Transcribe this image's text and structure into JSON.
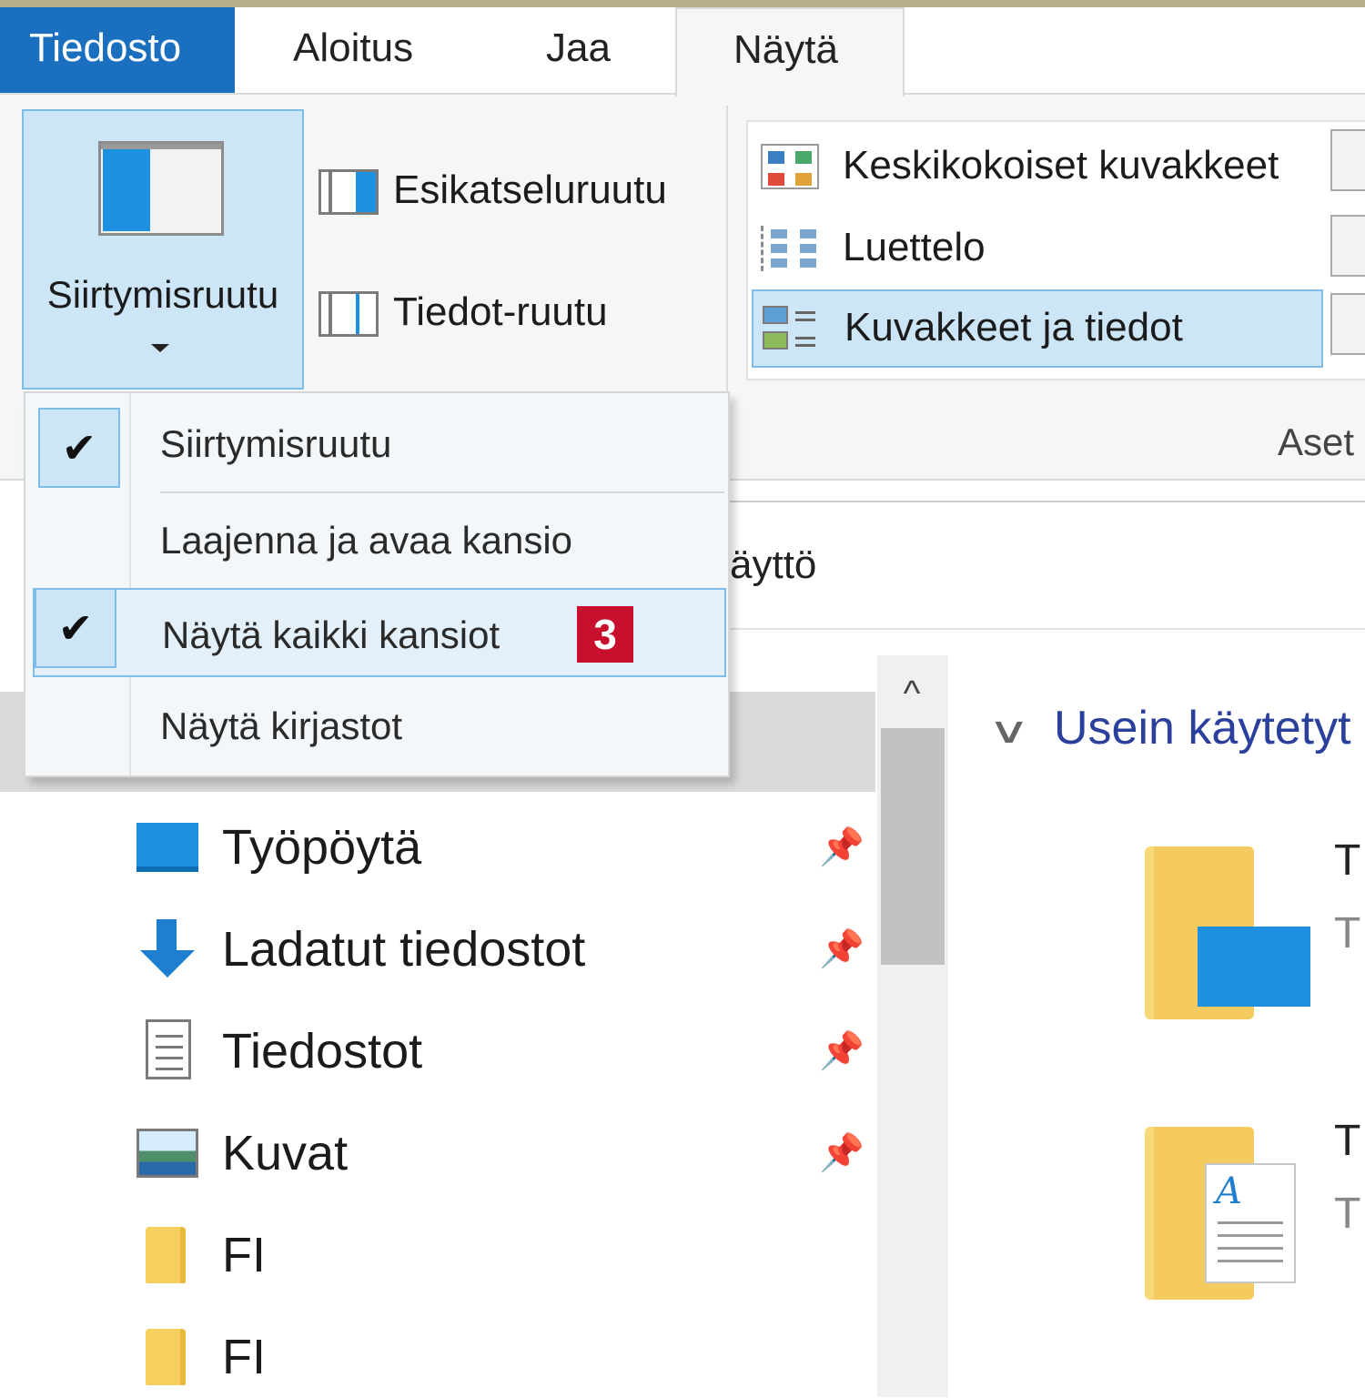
{
  "tabs": {
    "file": "Tiedosto",
    "home": "Aloitus",
    "share": "Jaa",
    "view": "Näytä"
  },
  "ribbon": {
    "panes": {
      "navigation_pane": "Siirtymisruutu",
      "preview_pane": "Esikatseluruutu",
      "details_pane": "Tiedot-ruutu"
    },
    "layout": {
      "medium_icons": "Keskikokoiset kuvakkeet",
      "list": "Luettelo",
      "tiles": "Kuvakkeet ja tiedot"
    },
    "options_label_clipped": "Aset"
  },
  "nav_menu": {
    "items": [
      {
        "label": "Siirtymisruutu",
        "checked": true
      },
      {
        "label": "Laajenna ja avaa kansio",
        "checked": false
      },
      {
        "label": "Näytä kaikki kansiot",
        "checked": true
      },
      {
        "label": "Näytä kirjastot",
        "checked": false
      }
    ],
    "check_glyph": "✔",
    "step_badge": "3"
  },
  "address": {
    "clipped_text": "äyttö"
  },
  "tree": {
    "items": [
      {
        "label": "Työpöytä",
        "icon": "desktop-icon",
        "pinned": true
      },
      {
        "label": "Ladatut tiedostot",
        "icon": "download-icon",
        "pinned": true
      },
      {
        "label": "Tiedostot",
        "icon": "documents-icon",
        "pinned": true
      },
      {
        "label": "Kuvat",
        "icon": "pictures-icon",
        "pinned": true
      },
      {
        "label": "FI",
        "icon": "folder-icon",
        "pinned": false
      },
      {
        "label": "FI",
        "icon": "folder-icon",
        "pinned": false
      }
    ],
    "pin_glyph": "📌",
    "scroll_up_glyph": "^"
  },
  "content": {
    "group_chevron": "∨",
    "group_title": "Usein käytetyt",
    "clipped": [
      "T",
      "T",
      "T",
      "T"
    ]
  },
  "colors": {
    "file_tab": "#1a6fbf",
    "selection": "#cde6f7",
    "selection_border": "#7dbde8",
    "badge": "#c8102e",
    "group_title": "#2b3f9c"
  }
}
